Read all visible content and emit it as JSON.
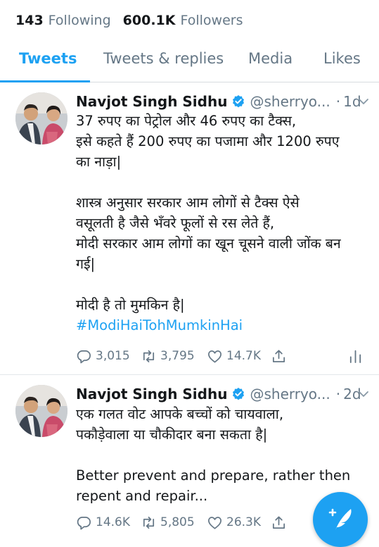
{
  "profile_stats": {
    "following_count": "143",
    "following_label": "Following",
    "followers_count": "600.1K",
    "followers_label": "Followers"
  },
  "tabs": [
    {
      "label": "Tweets",
      "active": true
    },
    {
      "label": "Tweets & replies",
      "active": false
    },
    {
      "label": "Media",
      "active": false
    },
    {
      "label": "Likes",
      "active": false
    }
  ],
  "tweets": [
    {
      "author_name": "Navjot Singh Sidhu",
      "handle": "@sherryo...",
      "dot": "·",
      "time": "1d",
      "body_lines": [
        "37 रुपए का पेट्रोल और 46 रुपए का टैक्स,",
        "इसे कहते हैं 200 रुपए का पजामा और 1200 रुपए",
        "का नाड़ा|",
        "",
        "शास्त्र अनुसार सरकार आम लोगों से टैक्स ऐसे",
        "वसूलती है जैसे भँवरे फूलों से रस लेते हैं,",
        "मोदी सरकार आम लोगों का खून चूसने वाली जोंक बन",
        "गई|",
        "",
        "मोदी है तो मुमकिन है|"
      ],
      "hashtag": "#ModiHaiTohMumkinHai",
      "replies": "3,015",
      "retweets": "3,795",
      "likes": "14.7K"
    },
    {
      "author_name": "Navjot Singh Sidhu",
      "handle": "@sherryo...",
      "dot": "·",
      "time": "2d",
      "body_lines": [
        "एक गलत वोट आपके बच्चों को चायवाला,",
        "पकौड़ेवाला या चौकीदार बना सकता है|",
        "",
        "Better prevent and prepare, rather then",
        "repent and repair..."
      ],
      "replies": "14.6K",
      "retweets": "5,805",
      "likes": "26.3K"
    }
  ],
  "icons": {
    "verified": "verified-badge-icon",
    "caret": "chevron-down-icon",
    "reply": "reply-icon",
    "retweet": "retweet-icon",
    "like": "heart-icon",
    "share": "share-icon",
    "analytics": "analytics-icon",
    "compose": "compose-tweet-icon"
  },
  "colors": {
    "accent": "#1da1f2",
    "text": "#14171a",
    "muted": "#657786"
  }
}
